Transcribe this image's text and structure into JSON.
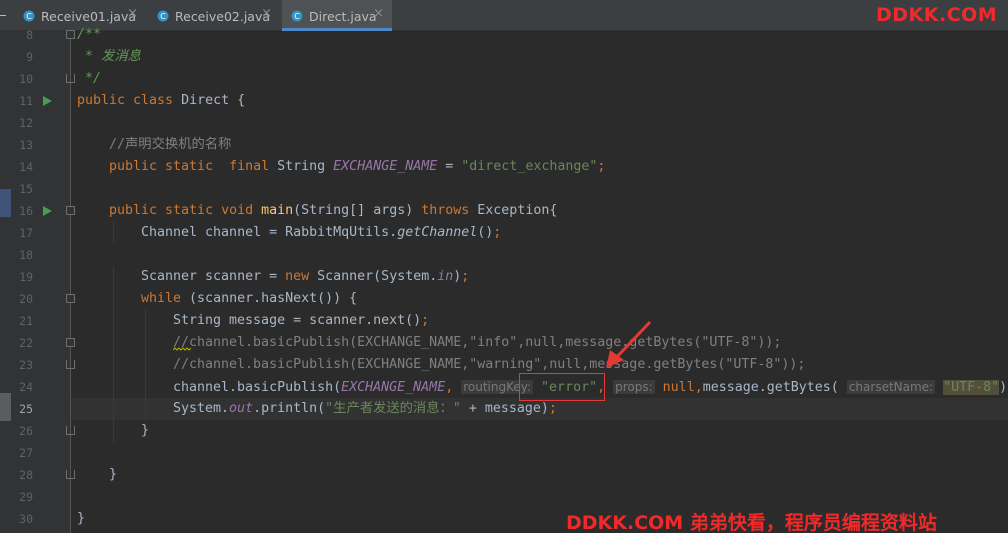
{
  "tabs": [
    {
      "label": "Receive01.java",
      "active": false
    },
    {
      "label": "Receive02.java",
      "active": false
    },
    {
      "label": "Direct.java",
      "active": true
    }
  ],
  "watermark_top": "DDKK.COM",
  "watermark_bottom": "DDKK.COM 弟弟快看，程序员编程资料站",
  "colors": {
    "keyword": "#cc7832",
    "string": "#6a8759",
    "comment": "#808080",
    "constant": "#9876aa",
    "method": "#ffc66d",
    "annotation_red": "#e53935",
    "run_icon": "#499c54"
  },
  "gutter_icons": [
    "run-icon",
    "fold-icon"
  ],
  "lines": [
    {
      "n": "8",
      "indent": 0,
      "fold": "start",
      "tokens": [
        [
          "t-doc",
          "/**"
        ]
      ]
    },
    {
      "n": "9",
      "indent": 0,
      "tokens": [
        [
          "t-doc",
          " * 发消息"
        ]
      ]
    },
    {
      "n": "10",
      "indent": 0,
      "fold": "end",
      "tokens": [
        [
          "t-doc",
          " */"
        ]
      ]
    },
    {
      "n": "11",
      "indent": 0,
      "run": true,
      "tokens": [
        [
          "t-kw",
          "public class "
        ],
        [
          "t-plain",
          "Direct {"
        ]
      ]
    },
    {
      "n": "12",
      "indent": 0,
      "tokens": []
    },
    {
      "n": "13",
      "indent": 1,
      "tokens": [
        [
          "t-cmt",
          "//声明交换机的名称"
        ]
      ]
    },
    {
      "n": "14",
      "indent": 1,
      "tokens": [
        [
          "t-kw",
          "public static  final "
        ],
        [
          "t-plain",
          "String "
        ],
        [
          "t-const",
          "EXCHANGE_NAME"
        ],
        [
          "t-plain",
          " = "
        ],
        [
          "t-str",
          "\"direct_exchange\""
        ],
        [
          "t-kw",
          ";"
        ]
      ]
    },
    {
      "n": "15",
      "indent": 0,
      "tokens": []
    },
    {
      "n": "16",
      "indent": 1,
      "run": true,
      "fold": "start",
      "tokens": [
        [
          "t-kw",
          "public static void "
        ],
        [
          "t-fn",
          "main"
        ],
        [
          "t-plain",
          "(String[] args) "
        ],
        [
          "t-kw",
          "throws "
        ],
        [
          "t-plain",
          "Exception{"
        ]
      ]
    },
    {
      "n": "17",
      "indent": 2,
      "tokens": [
        [
          "t-plain",
          "Channel channel = RabbitMqUtils."
        ],
        [
          "t-st",
          "getChannel"
        ],
        [
          "t-plain",
          "()"
        ],
        [
          "t-kw",
          ";"
        ]
      ]
    },
    {
      "n": "18",
      "indent": 0,
      "tokens": []
    },
    {
      "n": "19",
      "indent": 2,
      "tokens": [
        [
          "t-plain",
          "Scanner scanner = "
        ],
        [
          "t-kw",
          "new "
        ],
        [
          "t-plain",
          "Scanner(System."
        ],
        [
          "t-const",
          "in"
        ],
        [
          "t-plain",
          ")"
        ],
        [
          "t-kw",
          ";"
        ]
      ]
    },
    {
      "n": "20",
      "indent": 2,
      "fold": "start",
      "tokens": [
        [
          "t-kw",
          "while "
        ],
        [
          "t-plain",
          "(scanner.hasNext()) {"
        ]
      ]
    },
    {
      "n": "21",
      "indent": 3,
      "tokens": [
        [
          "t-plain",
          "String message = scanner.next()"
        ],
        [
          "t-kw",
          ";"
        ]
      ]
    },
    {
      "n": "22",
      "indent": 3,
      "fold": "start",
      "tokens": [
        [
          "t-cmt",
          "//channel.basicPublish(EXCHANGE_NAME,\"info\",null,message.getBytes(\"UTF-8\"));"
        ]
      ]
    },
    {
      "n": "23",
      "indent": 3,
      "fold": "end",
      "tokens": [
        [
          "t-cmt",
          "//channel.basicPublish(EXCHANGE_NAME,\"warning\",null,message.getBytes(\"UTF-8\"));"
        ]
      ]
    },
    {
      "n": "24",
      "indent": 3,
      "tokens": [
        [
          "t-plain",
          "channel.basicPublish("
        ],
        [
          "t-const",
          "EXCHANGE_NAME"
        ],
        [
          "t-kw",
          ", "
        ],
        [
          "t-hint",
          "routingKey:"
        ],
        [
          "t-plain",
          " "
        ],
        [
          "t-str",
          "\"error\""
        ],
        [
          "t-kw",
          ", "
        ],
        [
          "t-hint",
          "props:"
        ],
        [
          "t-plain",
          " "
        ],
        [
          "t-kw",
          "null"
        ],
        [
          "t-kw",
          ","
        ],
        [
          "t-plain",
          "message.getBytes( "
        ],
        [
          "t-hint",
          "charsetName:"
        ],
        [
          "t-plain",
          " "
        ],
        [
          "t-strhl",
          "\"UTF-8\""
        ],
        [
          "t-plain",
          "))"
        ],
        [
          "t-kw",
          ";"
        ]
      ]
    },
    {
      "n": "25",
      "indent": 3,
      "current": true,
      "tokens": [
        [
          "t-plain",
          "System."
        ],
        [
          "t-const",
          "out"
        ],
        [
          "t-plain",
          ".println("
        ],
        [
          "t-str",
          "\"生产者发送的消息：\""
        ],
        [
          "t-plain",
          " + message)"
        ],
        [
          "t-kw",
          ";"
        ]
      ]
    },
    {
      "n": "26",
      "indent": 2,
      "fold": "end",
      "tokens": [
        [
          "t-plain",
          "}"
        ]
      ]
    },
    {
      "n": "27",
      "indent": 0,
      "tokens": []
    },
    {
      "n": "28",
      "indent": 1,
      "fold": "end",
      "tokens": [
        [
          "t-plain",
          "}"
        ]
      ]
    },
    {
      "n": "29",
      "indent": 0,
      "tokens": []
    },
    {
      "n": "30",
      "indent": 0,
      "tokens": [
        [
          "t-plain",
          "}"
        ]
      ]
    }
  ]
}
